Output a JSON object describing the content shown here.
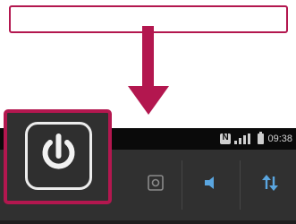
{
  "callout": {
    "text": ""
  },
  "status_bar": {
    "time": "09:38"
  },
  "quick_settings": {
    "buttons": [
      {
        "icon": "power-icon",
        "label": ""
      },
      {
        "icon": "screen-capture-icon",
        "label": ""
      },
      {
        "icon": "volume-icon",
        "label": ""
      },
      {
        "icon": "data-sync-icon",
        "label": ""
      }
    ]
  },
  "colors": {
    "accent": "#b3174f",
    "panel": "#303030",
    "status_bar": "#0a0a0a"
  }
}
